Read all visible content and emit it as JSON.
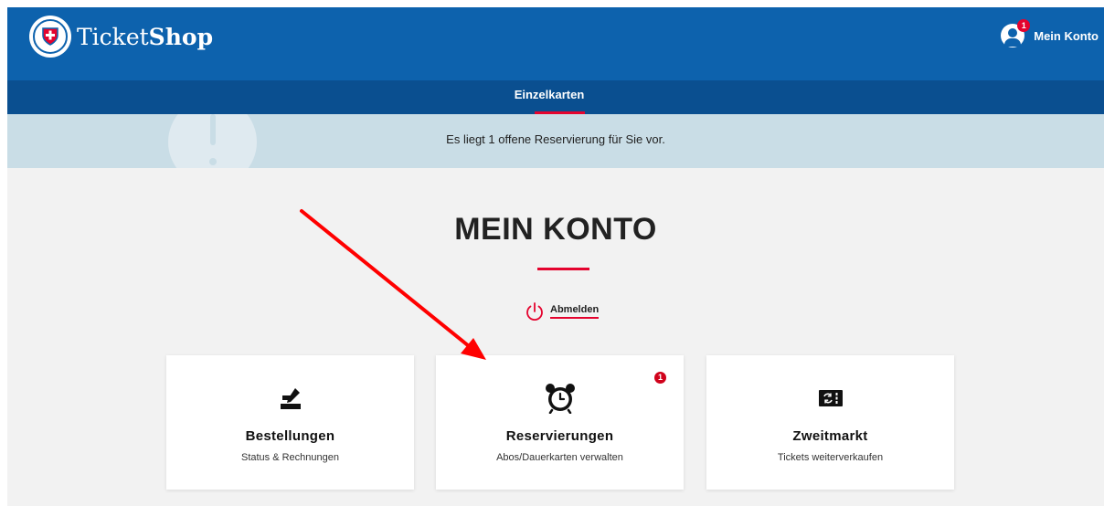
{
  "header": {
    "brand_light": "Ticket",
    "brand_bold": "Shop",
    "account_label": "Mein Konto",
    "account_badge": "1"
  },
  "nav": {
    "tabs": [
      {
        "label": "Einzelkarten",
        "active": true
      }
    ]
  },
  "alert": {
    "text": "Es liegt 1 offene Reservierung für Sie vor."
  },
  "main": {
    "title": "MEIN KONTO",
    "logout_label": "Abmelden"
  },
  "cards": [
    {
      "title": "Bestellungen",
      "subtitle": "Status & Rechnungen",
      "icon": "write-icon"
    },
    {
      "title": "Reservierungen",
      "subtitle": "Abos/Dauerkarten verwalten",
      "icon": "alarm-clock-icon",
      "badge": "1"
    },
    {
      "title": "Zweitmarkt",
      "subtitle": "Tickets weiterverkaufen",
      "icon": "ticket-exchange-icon"
    }
  ],
  "colors": {
    "primary_blue": "#0d62ad",
    "nav_blue": "#0a4f90",
    "accent_red": "#e4032e",
    "alert_bg": "#c9dde6",
    "page_bg": "#f2f2f2",
    "annotation_arrow": "#ff0000"
  }
}
